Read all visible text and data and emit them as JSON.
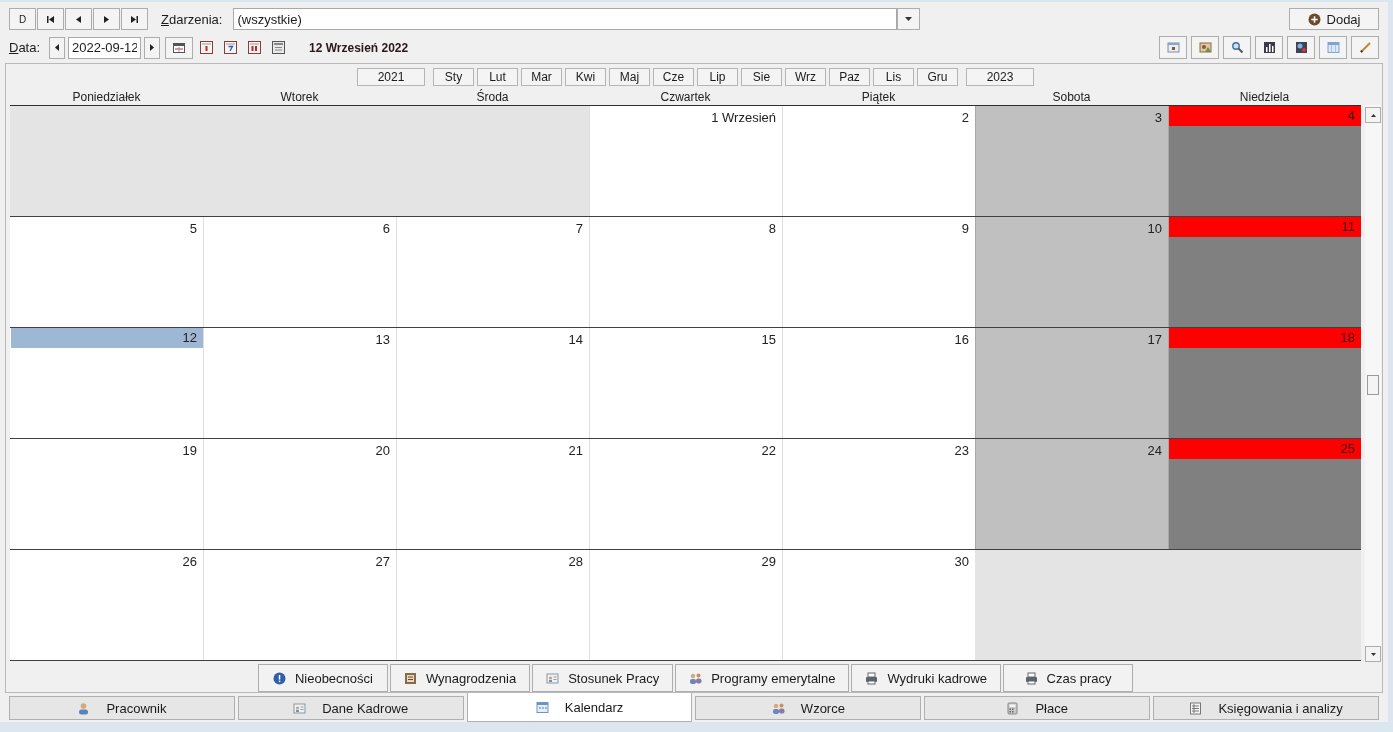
{
  "toolbar": {
    "nav_buttons": [
      {
        "kind": "text",
        "label": "D"
      },
      {
        "kind": "first"
      },
      {
        "kind": "prev"
      },
      {
        "kind": "next"
      },
      {
        "kind": "last"
      }
    ],
    "events": {
      "label": "Zdarzenia:",
      "value": "(wszystkie)"
    },
    "add_button": "Dodaj"
  },
  "date_bar": {
    "label": "Data:",
    "value": "2022-09-12",
    "heading": "12 Wrzesień 2022"
  },
  "calendar": {
    "prev_year": "2021",
    "months": [
      "Sty",
      "Lut",
      "Mar",
      "Kwi",
      "Maj",
      "Cze",
      "Lip",
      "Sie",
      "Wrz",
      "Paz",
      "Lis",
      "Gru"
    ],
    "next_year": "2023",
    "weekdays": [
      "Poniedziałek",
      "Wtorek",
      "Środa",
      "Czwartek",
      "Piątek",
      "Sobota",
      "Niedziela"
    ],
    "weeks": [
      {
        "days": [
          {
            "kind": "empty"
          },
          {
            "kind": "empty"
          },
          {
            "kind": "empty"
          },
          {
            "kind": "workday",
            "label": "1 Wrzesień",
            "selected": false
          },
          {
            "kind": "workday",
            "label": "2",
            "selected": false
          },
          {
            "kind": "saturday",
            "label": "3",
            "selected": false
          },
          {
            "kind": "sunday",
            "label": "4",
            "selected": false
          }
        ]
      },
      {
        "days": [
          {
            "kind": "workday",
            "label": "5",
            "selected": false
          },
          {
            "kind": "workday",
            "label": "6",
            "selected": false
          },
          {
            "kind": "workday",
            "label": "7",
            "selected": false
          },
          {
            "kind": "workday",
            "label": "8",
            "selected": false
          },
          {
            "kind": "workday",
            "label": "9",
            "selected": false
          },
          {
            "kind": "saturday",
            "label": "10",
            "selected": false
          },
          {
            "kind": "sunday",
            "label": "11",
            "selected": false
          }
        ]
      },
      {
        "days": [
          {
            "kind": "workday",
            "label": "12",
            "selected": true
          },
          {
            "kind": "workday",
            "label": "13",
            "selected": false
          },
          {
            "kind": "workday",
            "label": "14",
            "selected": false
          },
          {
            "kind": "workday",
            "label": "15",
            "selected": false
          },
          {
            "kind": "workday",
            "label": "16",
            "selected": false
          },
          {
            "kind": "saturday",
            "label": "17",
            "selected": false
          },
          {
            "kind": "sunday",
            "label": "18",
            "selected": false
          }
        ]
      },
      {
        "days": [
          {
            "kind": "workday",
            "label": "19",
            "selected": false
          },
          {
            "kind": "workday",
            "label": "20",
            "selected": false
          },
          {
            "kind": "workday",
            "label": "21",
            "selected": false
          },
          {
            "kind": "workday",
            "label": "22",
            "selected": false
          },
          {
            "kind": "workday",
            "label": "23",
            "selected": false
          },
          {
            "kind": "saturday",
            "label": "24",
            "selected": false
          },
          {
            "kind": "sunday",
            "label": "25",
            "selected": false
          }
        ]
      },
      {
        "days": [
          {
            "kind": "workday",
            "label": "26",
            "selected": false
          },
          {
            "kind": "workday",
            "label": "27",
            "selected": false
          },
          {
            "kind": "workday",
            "label": "28",
            "selected": false
          },
          {
            "kind": "workday",
            "label": "29",
            "selected": false
          },
          {
            "kind": "workday",
            "label": "30",
            "selected": false
          },
          {
            "kind": "empty"
          },
          {
            "kind": "empty"
          }
        ]
      }
    ]
  },
  "sub_tabs": [
    "Nieobecności",
    "Wynagrodzenia",
    "Stosunek Pracy",
    "Programy emerytalne",
    "Wydruki kadrowe",
    "Czas pracy"
  ],
  "main_tabs": [
    {
      "label": "Pracownik",
      "selected": false
    },
    {
      "label": "Dane Kadrowe",
      "selected": false
    },
    {
      "label": "Kalendarz",
      "selected": true
    },
    {
      "label": "Wzorce",
      "selected": false
    },
    {
      "label": "Płace",
      "selected": false
    },
    {
      "label": "Księgowania i analizy",
      "selected": false
    }
  ]
}
